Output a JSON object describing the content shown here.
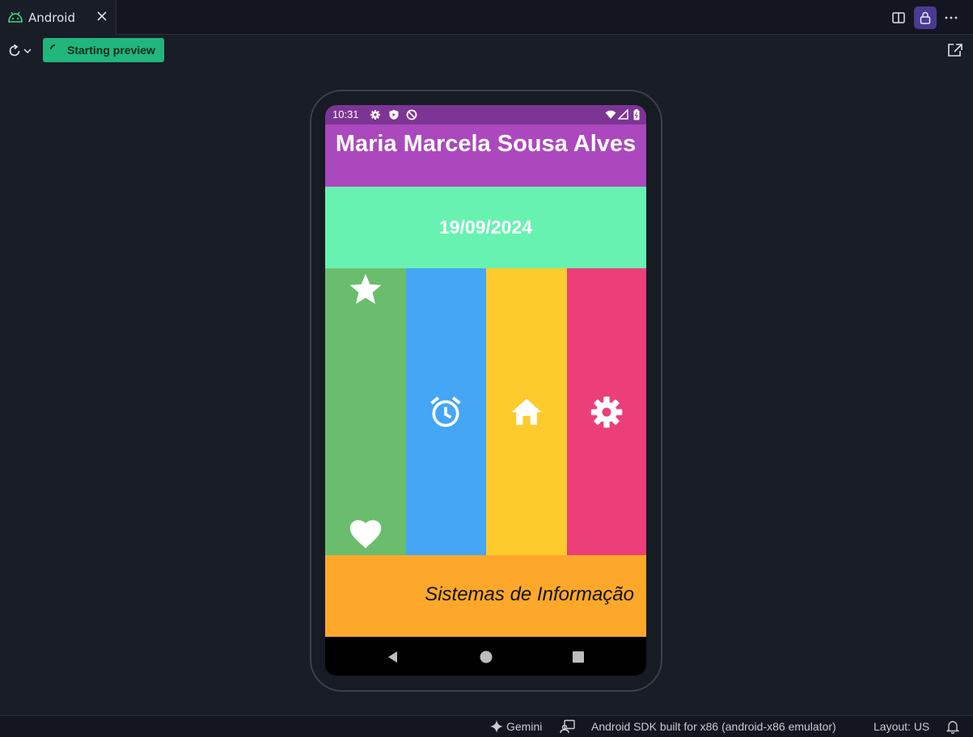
{
  "tab": {
    "title": "Android",
    "icon": "android-icon"
  },
  "toolbar": {
    "preview_label": "Starting preview"
  },
  "device": {
    "status_time": "10:31",
    "name": "Maria Marcela Sousa Alves",
    "date": "19/09/2024",
    "footer": "Sistemas de Informação",
    "colors": {
      "status": "#7c3594",
      "name_bg": "#ab48bd",
      "date_bg": "#68f2b2",
      "green": "#6abd6c",
      "blue": "#44a6f4",
      "yellow": "#fecb2c",
      "pink": "#ec3f79",
      "footer_bg": "#fda82a"
    },
    "column_icons": [
      "star-icon",
      "heart-icon",
      "alarm-icon",
      "home-icon",
      "settings-icon"
    ]
  },
  "statusbar": {
    "gemini": "Gemini",
    "device": "Android SDK built for x86 (android-x86 emulator)",
    "layout": "Layout: US"
  }
}
